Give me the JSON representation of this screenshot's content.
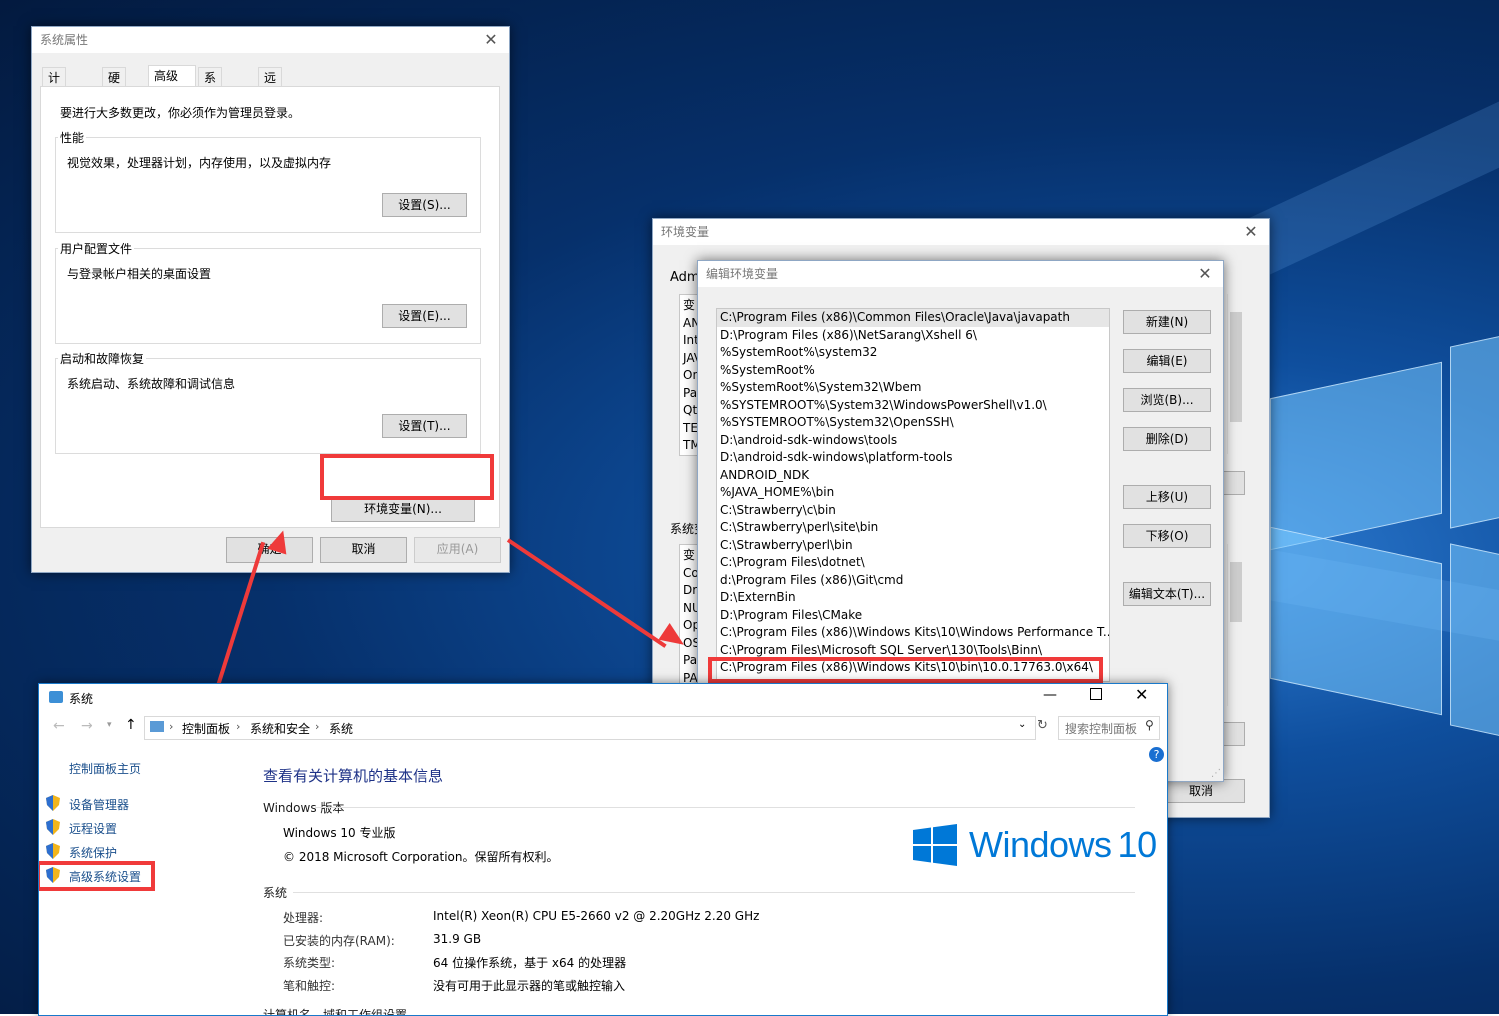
{
  "sysprops": {
    "title": "系统属性",
    "tabs": [
      "计算机名",
      "硬件",
      "高级",
      "系统保护",
      "远程"
    ],
    "admin_note": "要进行大多数更改，你必须作为管理员登录。",
    "performance": {
      "label": "性能",
      "desc": "视觉效果，处理器计划，内存使用，以及虚拟内存",
      "button": "设置(S)..."
    },
    "profile": {
      "label": "用户配置文件",
      "desc": "与登录帐户相关的桌面设置",
      "button": "设置(E)..."
    },
    "startup": {
      "label": "启动和故障恢复",
      "desc": "系统启动、系统故障和调试信息",
      "button": "设置(T)..."
    },
    "env_button": "环境变量(N)...",
    "ok": "确定",
    "cancel": "取消",
    "apply": "应用(A)"
  },
  "envvars": {
    "title": "环境变量",
    "user_section": "Adm",
    "user_rows": [
      "变",
      "AN",
      "Int",
      "JAV",
      "On",
      "Pat",
      "Qt",
      "TE",
      "TM"
    ],
    "system_section": "系统变",
    "system_rows": [
      "变",
      "Co",
      "Dri",
      "NU",
      "Op",
      "OS",
      "Pat",
      "PA"
    ],
    "cancel_partial": "消",
    "cancel": "取消"
  },
  "editenv": {
    "title": "编辑环境变量",
    "paths": [
      "C:\\Program Files (x86)\\Common Files\\Oracle\\Java\\javapath",
      "D:\\Program Files (x86)\\NetSarang\\Xshell 6\\",
      "%SystemRoot%\\system32",
      "%SystemRoot%",
      "%SystemRoot%\\System32\\Wbem",
      "%SYSTEMROOT%\\System32\\WindowsPowerShell\\v1.0\\",
      "%SYSTEMROOT%\\System32\\OpenSSH\\",
      "D:\\android-sdk-windows\\tools",
      "D:\\android-sdk-windows\\platform-tools",
      "ANDROID_NDK",
      "%JAVA_HOME%\\bin",
      "C:\\Strawberry\\c\\bin",
      "C:\\Strawberry\\perl\\site\\bin",
      "C:\\Strawberry\\perl\\bin",
      "C:\\Program Files\\dotnet\\",
      "d:\\Program Files (x86)\\Git\\cmd",
      "D:\\ExternBin",
      "D:\\Program Files\\CMake",
      "C:\\Program Files (x86)\\Windows Kits\\10\\Windows Performance T...",
      "C:\\Program Files\\Microsoft SQL Server\\130\\Tools\\Binn\\",
      "C:\\Program Files (x86)\\Windows Kits\\10\\bin\\10.0.17763.0\\x64\\"
    ],
    "buttons": {
      "new": "新建(N)",
      "edit": "编辑(E)",
      "browse": "浏览(B)...",
      "delete": "删除(D)",
      "up": "上移(U)",
      "down": "下移(O)",
      "edit_text": "编辑文本(T)..."
    }
  },
  "system": {
    "title": "系统",
    "breadcrumb": [
      "控制面板",
      "系统和安全",
      "系统"
    ],
    "search_placeholder": "搜索控制面板",
    "sidebar_home": "控制面板主页",
    "sidebar_links": [
      "设备管理器",
      "远程设置",
      "系统保护",
      "高级系统设置"
    ],
    "heading": "查看有关计算机的基本信息",
    "edition_section": "Windows 版本",
    "edition": "Windows 10 专业版",
    "copyright": "© 2018 Microsoft Corporation。保留所有权利。",
    "logo_text": "Windows",
    "logo_num": "10",
    "system_section": "系统",
    "specs": [
      {
        "label": "处理器:",
        "value": "Intel(R) Xeon(R) CPU E5-2660 v2 @ 2.20GHz   2.20 GHz"
      },
      {
        "label": "已安装的内存(RAM):",
        "value": "31.9 GB"
      },
      {
        "label": "系统类型:",
        "value": "64 位操作系统，基于 x64 的处理器"
      },
      {
        "label": "笔和触控:",
        "value": "没有可用于此显示器的笔或触控输入"
      }
    ],
    "cut_section": "计算机名、域和工作组设置",
    "help": "?"
  }
}
